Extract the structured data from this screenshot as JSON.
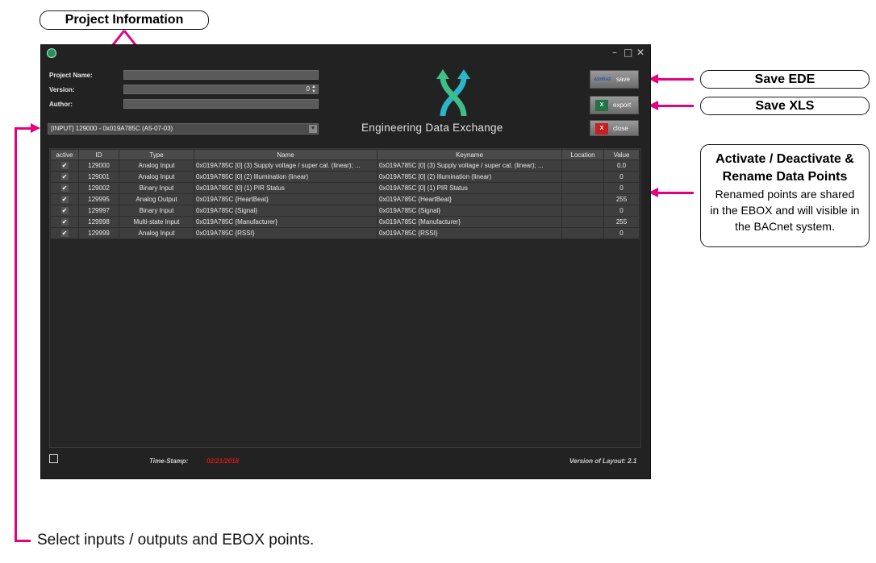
{
  "annotations": {
    "project_information": "Project Information",
    "save_ede": "Save EDE",
    "save_xls": "Save XLS",
    "activate_title_line1": "Activate / Deactivate &",
    "activate_title_line2": "Rename Data Points",
    "activate_desc_line1": "Renamed points are shared",
    "activate_desc_line2": "in the EBOX and will visible in",
    "activate_desc_line3": "the BACnet system.",
    "select_points": "Select inputs / outputs and EBOX points."
  },
  "colors": {
    "accent": "#e6007e",
    "window_bg": "#222222",
    "timestamp": "#d01818"
  },
  "window": {
    "controls": {
      "minimize": "–",
      "maximize": "□",
      "close": "✕"
    },
    "form": {
      "project_name_label": "Project Name:",
      "project_name_value": "",
      "version_label": "Version:",
      "version_value": "0",
      "author_label": "Author:",
      "author_value": ""
    },
    "selector": {
      "selected": "[INPUT] 129000 - 0x019A785C (A5-07-03)"
    },
    "logo": {
      "text": "Engineering Data Exchange"
    },
    "buttons": {
      "save_label": "save",
      "save_icon_text": "ASHRAE",
      "export_label": "export",
      "export_icon_text": "X",
      "close_label": "close",
      "close_icon_text": "X"
    },
    "table": {
      "headers": [
        "active",
        "ID",
        "Type",
        "Name",
        "Keyname",
        "Location",
        "Value"
      ],
      "rows": [
        {
          "active": "✔",
          "id": "129000",
          "type": "Analog Input",
          "name": "0x019A785C [0] (3) Supply voltage / super cal. (linear); ...",
          "keyname": "0x019A785C [0] (3) Supply voltage / super cal. (linear); ...",
          "location": "",
          "value": "0.0"
        },
        {
          "active": "✔",
          "id": "129001",
          "type": "Analog Input",
          "name": "0x019A785C [0] (2) Illumination (linear)",
          "keyname": "0x019A785C [0] (2) Illumination (linear)",
          "location": "",
          "value": "0"
        },
        {
          "active": "✔",
          "id": "129002",
          "type": "Binary Input",
          "name": "0x019A785C [0] (1) PIR Status",
          "keyname": "0x019A785C [0] (1) PIR Status",
          "location": "",
          "value": "0"
        },
        {
          "active": "✔",
          "id": "129995",
          "type": "Analog Output",
          "name": "0x019A785C {HeartBeat}",
          "keyname": "0x019A785C {HeartBeat}",
          "location": "",
          "value": "255"
        },
        {
          "active": "✔",
          "id": "129997",
          "type": "Binary Input",
          "name": "0x019A785C {Signal}",
          "keyname": "0x019A785C {Signal}",
          "location": "",
          "value": "0"
        },
        {
          "active": "✔",
          "id": "129998",
          "type": "Multi-state Input",
          "name": "0x019A785C {Manufacturer}",
          "keyname": "0x019A785C {Manufacturer}",
          "location": "",
          "value": "255"
        },
        {
          "active": "✔",
          "id": "129999",
          "type": "Analog Input",
          "name": "0x019A785C {RSSI}",
          "keyname": "0x019A785C {RSSI}",
          "location": "",
          "value": "0"
        }
      ]
    },
    "footer": {
      "timestamp_label": "Time-Stamp:",
      "timestamp_value": "02/21/2018",
      "version_layout": "Version of Layout: 2.1"
    }
  }
}
